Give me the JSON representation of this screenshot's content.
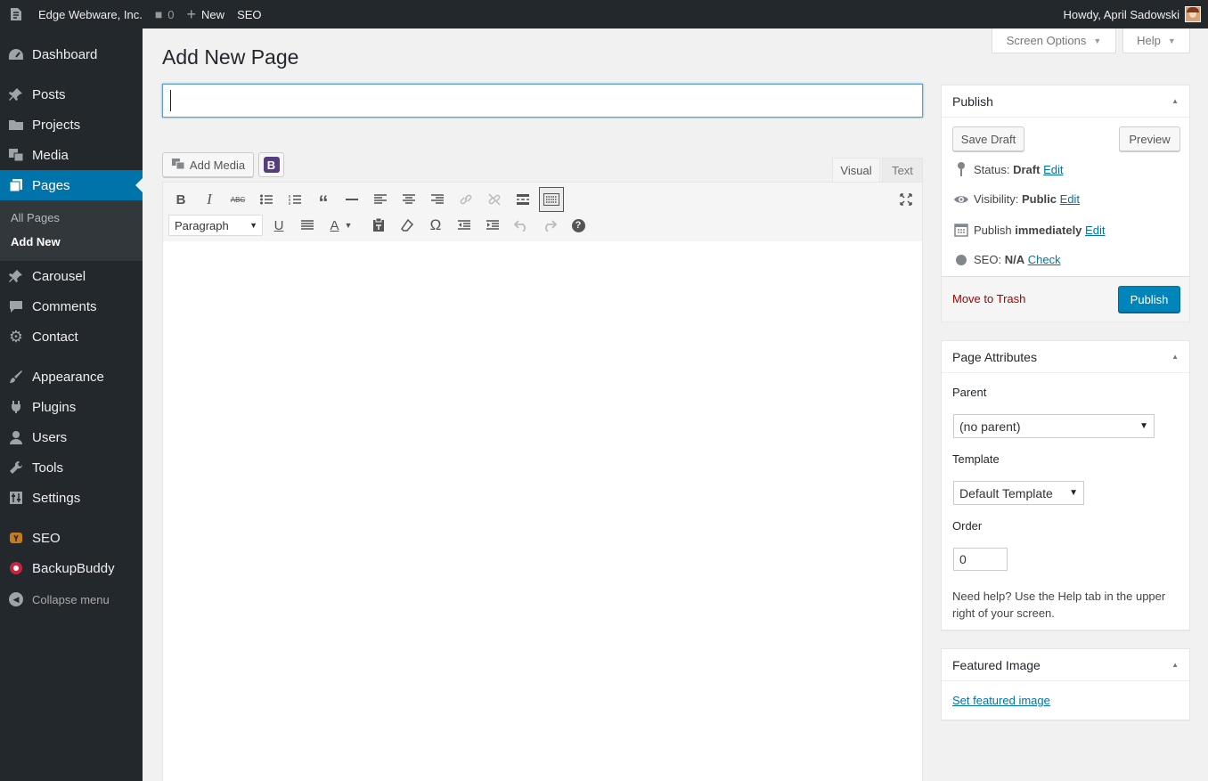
{
  "admin_bar": {
    "site_name": "Edge Webware, Inc.",
    "comments_count": "0",
    "new_label": "New",
    "seo_label": "SEO",
    "greeting": "Howdy, April Sadowski"
  },
  "sidebar": {
    "items": [
      {
        "label": "Dashboard",
        "icon": "dashboard-icon"
      },
      {
        "label": "Posts",
        "icon": "pin-icon"
      },
      {
        "label": "Projects",
        "icon": "folder-icon"
      },
      {
        "label": "Media",
        "icon": "media-icon"
      },
      {
        "label": "Pages",
        "icon": "pages-icon"
      },
      {
        "label": "Carousel",
        "icon": "pin-icon"
      },
      {
        "label": "Comments",
        "icon": "comment-icon"
      },
      {
        "label": "Contact",
        "icon": "gear-icon"
      },
      {
        "label": "Appearance",
        "icon": "brush-icon"
      },
      {
        "label": "Plugins",
        "icon": "plug-icon"
      },
      {
        "label": "Users",
        "icon": "user-icon"
      },
      {
        "label": "Tools",
        "icon": "wrench-icon"
      },
      {
        "label": "Settings",
        "icon": "settings-icon"
      },
      {
        "label": "SEO",
        "icon": "seo-icon"
      },
      {
        "label": "BackupBuddy",
        "icon": "backup-icon"
      }
    ],
    "submenu": {
      "all_pages": "All Pages",
      "add_new": "Add New"
    },
    "collapse_label": "Collapse menu"
  },
  "screen_options": "Screen Options",
  "help": "Help",
  "page_title": "Add New Page",
  "title_input": {
    "value": "",
    "placeholder": ""
  },
  "editor": {
    "add_media": "Add Media",
    "bootstrap_letter": "B",
    "tab_visual": "Visual",
    "tab_text": "Text",
    "format_select": "Paragraph",
    "text_color_letter": "A"
  },
  "publish": {
    "title": "Publish",
    "save_draft": "Save Draft",
    "preview": "Preview",
    "status_label": "Status:",
    "status_value": "Draft",
    "visibility_label": "Visibility:",
    "visibility_value": "Public",
    "publish_label": "Publish",
    "publish_value": "immediately",
    "seo_label": "SEO:",
    "seo_value": "N/A",
    "edit": "Edit",
    "check": "Check",
    "trash": "Move to Trash",
    "publish_button": "Publish"
  },
  "page_attributes": {
    "title": "Page Attributes",
    "parent_label": "Parent",
    "parent_value": "(no parent)",
    "template_label": "Template",
    "template_value": "Default Template",
    "order_label": "Order",
    "order_value": "0",
    "help": "Need help? Use the Help tab in the upper right of your screen."
  },
  "featured_image": {
    "title": "Featured Image",
    "link": "Set featured image"
  }
}
